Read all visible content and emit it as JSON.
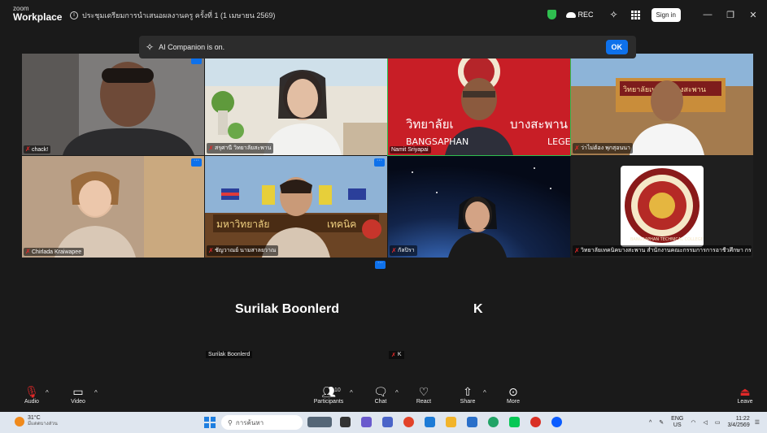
{
  "app": {
    "logo_line1": "zoom",
    "logo_line2": "Workplace"
  },
  "meeting": {
    "title": "ประชุมเตรียมการนำเสนอผลงานครู ครั้งที่ 1 (1 เมษายน 2569)"
  },
  "titlebar": {
    "rec_label": "REC",
    "signin_label": "Sign in"
  },
  "ai_banner": {
    "text": "AI Companion is on.",
    "ok_label": "OK"
  },
  "participants": [
    {
      "name": "chack!"
    },
    {
      "name": "สรุศานี วิทยาลัยสะพาน"
    },
    {
      "name": "Namit Sriyapai"
    },
    {
      "name": "ว่าไม่ต้อง พุกสุอนนา"
    },
    {
      "name": "Chirlada Kraiwapee"
    },
    {
      "name": "ชัญวาณย์ นามสาลยวาณ"
    },
    {
      "name": "กัลปิรา"
    },
    {
      "name": "วิทยาลัยเทคนิคบางสะพาน สำนักงานคณะกรรมการการอาชีวศึกษา กระ..."
    }
  ],
  "tile_overlays": {
    "tile2_banner_top": "วิทยาลัยเ",
    "tile2_banner_right": "บางสะพาน",
    "tile2_banner_sub": "BANGSAPHAN",
    "tile2_banner_sub2": "LEGE",
    "tile3_sign1": "วิทยาลัยเทคนิคบางสะพาน",
    "tile5_sign1": "มหาวิทยาลัย",
    "tile5_sign2": "เทคนิค",
    "tile7_seal_text": "BANGSAPHAN TECHNICAL COLLEGE"
  },
  "audio_only": [
    {
      "name": "Surilak Boonlerd",
      "tag": "Surilak Boonlerd"
    },
    {
      "name": "K",
      "tag": "K"
    }
  ],
  "toolbar": {
    "audio": "Audio",
    "video": "Video",
    "participants": "Participants",
    "participants_count": "10",
    "chat": "Chat",
    "react": "React",
    "share": "Share",
    "more": "More",
    "leave": "Leave"
  },
  "taskbar": {
    "weather_temp": "31°C",
    "weather_desc": "มีแดดบางส่วน",
    "search_placeholder": "การค้นหา",
    "lang1": "ENG",
    "lang2": "US",
    "time": "11:22",
    "date": "3/4/2569"
  },
  "colors": {
    "accent": "#0e71eb",
    "active_speaker": "#2fbf4f",
    "mute": "#e02828"
  }
}
